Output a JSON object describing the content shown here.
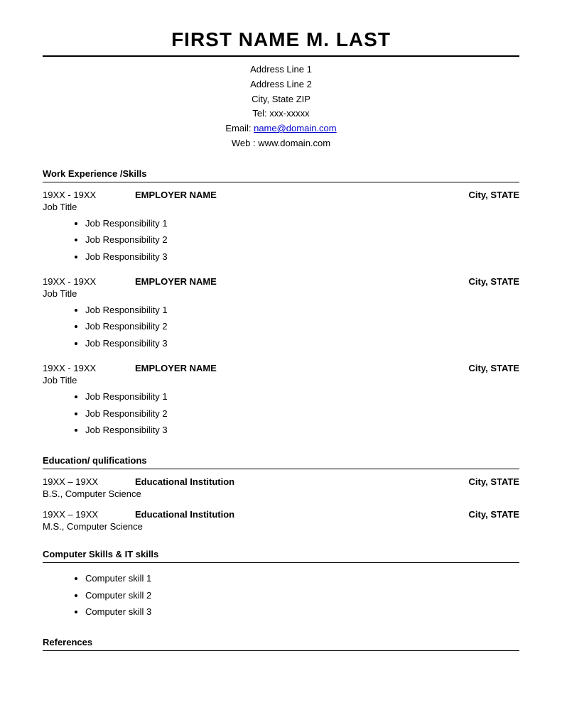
{
  "header": {
    "name": "FIRST NAME M. LAST",
    "address_line1": "Address Line 1",
    "address_line2": "Address Line 2",
    "city_state_zip": "City, State ZIP",
    "tel": "Tel: xxx-xxxxx",
    "email_label": "Email: ",
    "email_link": "name@domain.com",
    "email_href": "mailto:name@domain.com",
    "web": "Web : www.domain.com"
  },
  "sections": {
    "work_experience": {
      "title": "Work Experience /Skills",
      "jobs": [
        {
          "dates": "19XX - 19XX",
          "employer": "EMPLOYER NAME",
          "location": "City, STATE",
          "title": "Job Title",
          "responsibilities": [
            "Job Responsibility 1",
            "Job Responsibility 2",
            "Job Responsibility 3"
          ]
        },
        {
          "dates": "19XX - 19XX",
          "employer": "EMPLOYER NAME",
          "location": "City, STATE",
          "title": "Job Title",
          "responsibilities": [
            "Job Responsibility 1",
            "Job Responsibility 2",
            "Job Responsibility 3"
          ]
        },
        {
          "dates": "19XX - 19XX",
          "employer": "EMPLOYER NAME",
          "location": "City, STATE",
          "title": "Job Title",
          "responsibilities": [
            "Job Responsibility 1",
            "Job Responsibility 2",
            "Job Responsibility 3"
          ]
        }
      ]
    },
    "education": {
      "title": "Education/ qulifications",
      "entries": [
        {
          "dates": "19XX – 19XX",
          "institution": "Educational Institution",
          "location": "City, STATE",
          "degree": "B.S., Computer Science"
        },
        {
          "dates": "19XX – 19XX",
          "institution": "Educational Institution",
          "location": "City, STATE",
          "degree": "M.S., Computer Science"
        }
      ]
    },
    "computer_skills": {
      "title": "Computer Skills & IT skills",
      "skills": [
        "Computer skill 1",
        "Computer skill 2",
        "Computer skill 3"
      ]
    },
    "references": {
      "title": "References"
    }
  }
}
